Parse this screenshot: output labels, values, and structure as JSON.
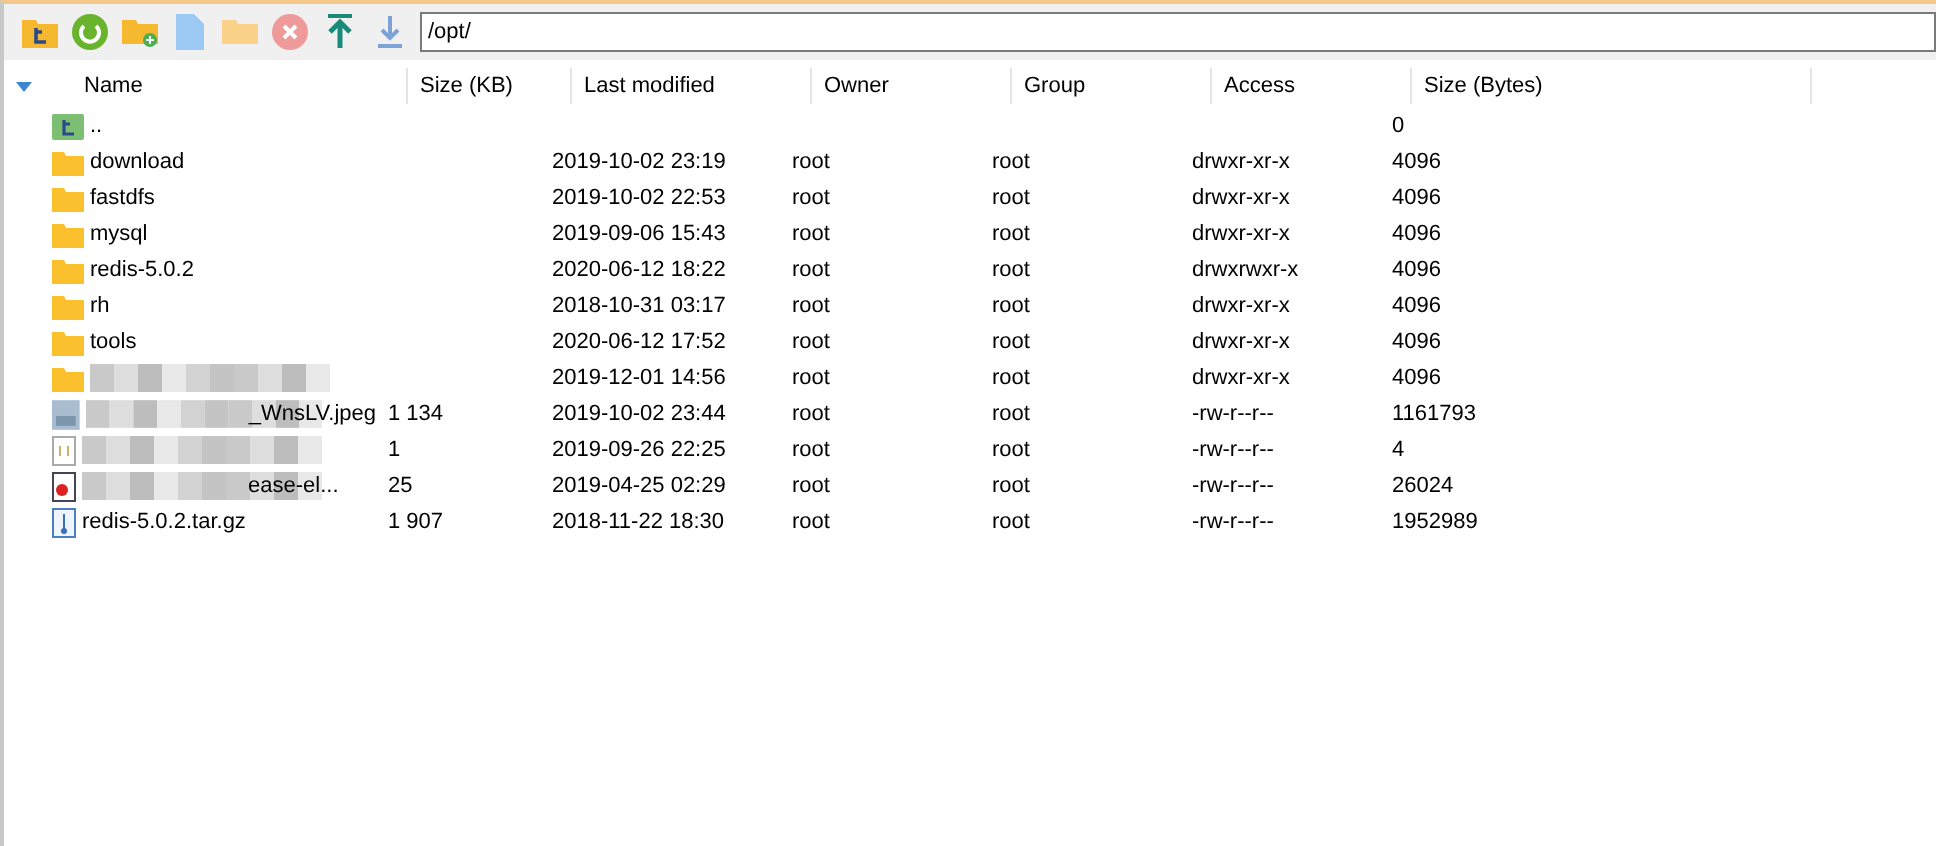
{
  "path": "/opt/",
  "columns": [
    {
      "label": "Name"
    },
    {
      "label": "Size (KB)"
    },
    {
      "label": "Last modified"
    },
    {
      "label": "Owner"
    },
    {
      "label": "Group"
    },
    {
      "label": "Access"
    },
    {
      "label": "Size (Bytes)"
    }
  ],
  "rows": [
    {
      "kind": "parent",
      "name": "..",
      "size_kb": "",
      "modified": "",
      "owner": "",
      "group": "",
      "access": "",
      "size_bytes": "0"
    },
    {
      "kind": "folder",
      "name": "download",
      "size_kb": "",
      "modified": "2019-10-02 23:19",
      "owner": "root",
      "group": "root",
      "access": "drwxr-xr-x",
      "size_bytes": "4096"
    },
    {
      "kind": "folder",
      "name": "fastdfs",
      "size_kb": "",
      "modified": "2019-10-02 22:53",
      "owner": "root",
      "group": "root",
      "access": "drwxr-xr-x",
      "size_bytes": "4096"
    },
    {
      "kind": "folder",
      "name": "mysql",
      "size_kb": "",
      "modified": "2019-09-06 15:43",
      "owner": "root",
      "group": "root",
      "access": "drwxr-xr-x",
      "size_bytes": "4096"
    },
    {
      "kind": "folder",
      "name": "redis-5.0.2",
      "size_kb": "",
      "modified": "2020-06-12 18:22",
      "owner": "root",
      "group": "root",
      "access": "drwxrwxr-x",
      "size_bytes": "4096"
    },
    {
      "kind": "folder",
      "name": "rh",
      "size_kb": "",
      "modified": "2018-10-31 03:17",
      "owner": "root",
      "group": "root",
      "access": "drwxr-xr-x",
      "size_bytes": "4096"
    },
    {
      "kind": "folder",
      "name": "tools",
      "size_kb": "",
      "modified": "2020-06-12 17:52",
      "owner": "root",
      "group": "root",
      "access": "drwxr-xr-x",
      "size_bytes": "4096"
    },
    {
      "kind": "folder",
      "name": "",
      "masked": true,
      "size_kb": "",
      "modified": "2019-12-01 14:56",
      "owner": "root",
      "group": "root",
      "access": "drwxr-xr-x",
      "size_bytes": "4096"
    },
    {
      "kind": "image",
      "name": "_WnsLV.jpeg",
      "masked": true,
      "size_kb": "1 134",
      "modified": "2019-10-02 23:44",
      "owner": "root",
      "group": "root",
      "access": "-rw-r--r--",
      "size_bytes": "1161793"
    },
    {
      "kind": "text",
      "name": "",
      "masked": true,
      "size_kb": "1",
      "modified": "2019-09-26 22:25",
      "owner": "root",
      "group": "root",
      "access": "-rw-r--r--",
      "size_bytes": "4"
    },
    {
      "kind": "app",
      "name": "ease-el...",
      "masked": true,
      "size_kb": "25",
      "modified": "2019-04-25 02:29",
      "owner": "root",
      "group": "root",
      "access": "-rw-r--r--",
      "size_bytes": "26024"
    },
    {
      "kind": "archive",
      "name": "redis-5.0.2.tar.gz",
      "size_kb": "1 907",
      "modified": "2018-11-22 18:30",
      "owner": "root",
      "group": "root",
      "access": "-rw-r--r--",
      "size_bytes": "1952989"
    }
  ]
}
